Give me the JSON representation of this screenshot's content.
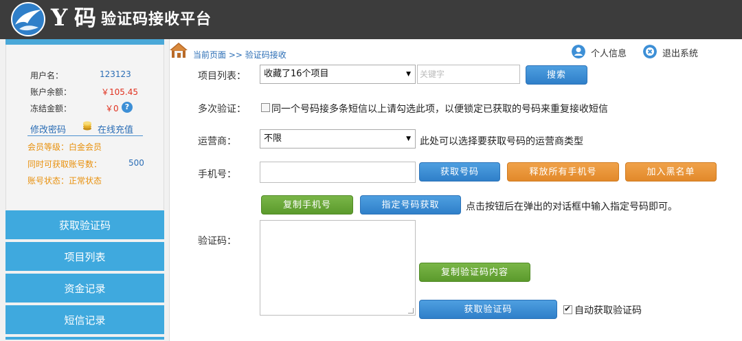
{
  "header": {
    "brand_y": "Y",
    "brand_ma": "码",
    "title": "验证码接收平台"
  },
  "user": {
    "username_label": "用户名：",
    "username": "123123",
    "balance_label": "账户余额：",
    "balance": "￥105.45",
    "frozen_label": "冻结金额：",
    "frozen": "￥0",
    "help": "?",
    "change_password": "修改密码",
    "recharge": "在线充值",
    "level": "会员等级：白金会员",
    "concurrent_label": "同时可获取账号数：",
    "concurrent_value": "500",
    "status": "账号状态：正常状态"
  },
  "nav": {
    "items": [
      {
        "label": "获取验证码"
      },
      {
        "label": "项目列表"
      },
      {
        "label": "资金记录"
      },
      {
        "label": "短信记录"
      }
    ]
  },
  "breadcrumb": {
    "text": "当前页面 >> 验证码接收"
  },
  "topbar": {
    "user_info": "个人信息",
    "logout": "退出系统"
  },
  "form": {
    "project_label": "项目列表：",
    "project_value": "收藏了16个项目",
    "keyword_placeholder": "关键字",
    "search_button": "搜索",
    "multi_label": "多次验证：",
    "multi_desc": "同一个号码接多条短信以上请勾选此项，以便锁定已获取的号码来重复接收短信",
    "carrier_label": "运营商：",
    "carrier_value": "不限",
    "carrier_desc": "此处可以选择要获取号码的运营商类型",
    "phone_label": "手机号：",
    "get_number_button": "获取号码",
    "release_all_button": "释放所有手机号",
    "blacklist_button": "加入黑名单",
    "copy_phone_button": "复制手机号",
    "specify_button": "指定号码获取",
    "specify_desc": "点击按钮后在弹出的对话框中输入指定号码即可。",
    "code_label": "验证码：",
    "copy_code_button": "复制验证码内容",
    "get_code_button": "获取验证码",
    "auto_label": "自动获取验证码"
  },
  "colors": {
    "header_bg": "#3c3c3c",
    "nav_bg": "#3fa9de",
    "accent_blue": "#2f7fc9",
    "accent_orange": "#e2892a",
    "accent_green": "#5b9a2c",
    "price_red": "#e0301e"
  }
}
